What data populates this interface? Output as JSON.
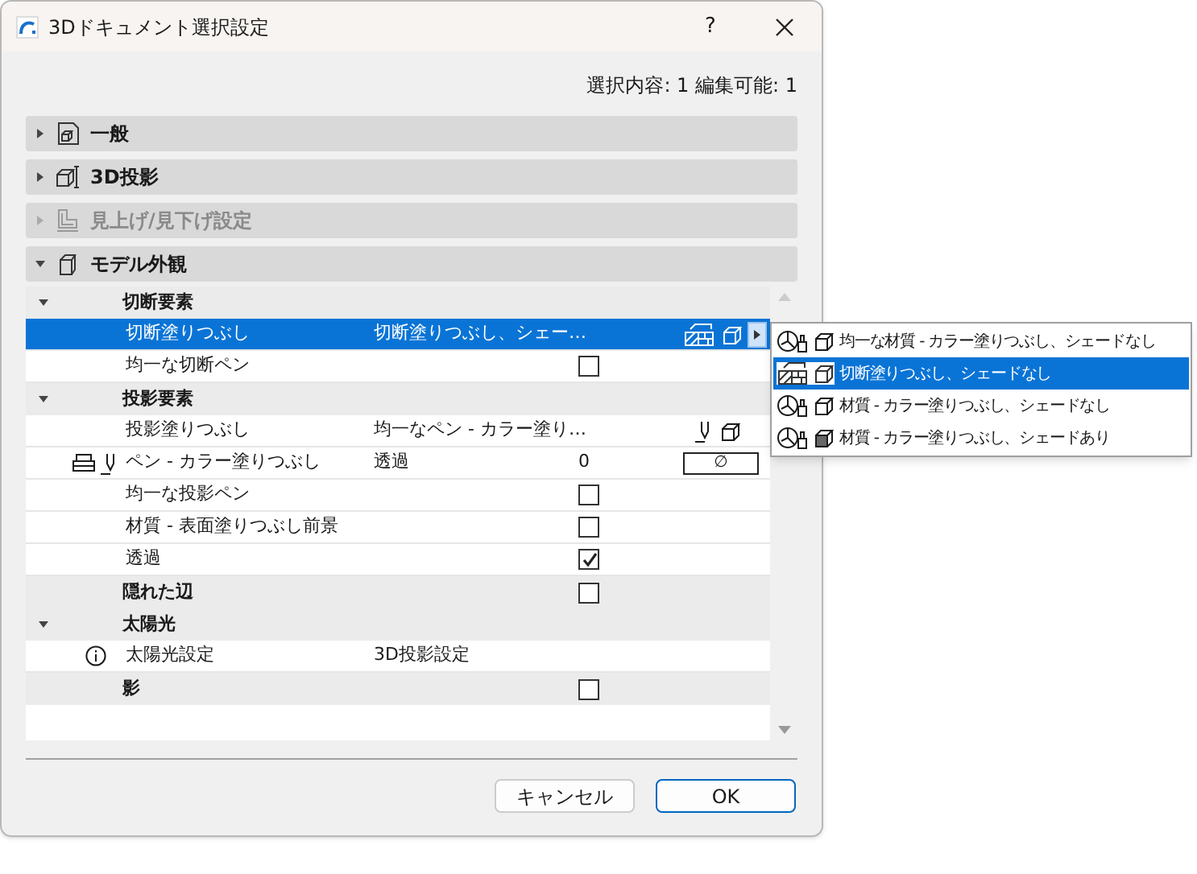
{
  "window": {
    "title": "3Dドキュメント選択設定",
    "help": "?"
  },
  "selection_info": "選択内容: 1 編集可能: 1",
  "sections": [
    {
      "label": "一般",
      "kind": "general",
      "expanded": false,
      "disabled": false
    },
    {
      "label": "3D投影",
      "kind": "projection",
      "expanded": false,
      "disabled": false
    },
    {
      "label": "見上げ/見下げ設定",
      "kind": "floor",
      "expanded": false,
      "disabled": true
    },
    {
      "label": "モデル外観",
      "kind": "model",
      "expanded": true,
      "disabled": false
    }
  ],
  "tree": [
    {
      "label": "切断要素",
      "expanded": true,
      "children": [
        {
          "kind": "cut-fill",
          "label": "切断塗りつぶし",
          "value": "切断塗りつぶし、シェー…",
          "selected": true
        },
        {
          "kind": "check",
          "label": "均一な切断ペン",
          "checked": false,
          "selected": false
        }
      ]
    },
    {
      "label": "投影要素",
      "expanded": true,
      "children": [
        {
          "kind": "projection-fill",
          "label": "投影塗りつぶし",
          "value": "均一なペン - カラー塗り…",
          "selected": false
        },
        {
          "kind": "pen",
          "label": "ペン - カラー塗りつぶし",
          "value": "透過",
          "number": "0",
          "swatch": "∅",
          "selected": false
        },
        {
          "kind": "check",
          "label": "均一な投影ペン",
          "checked": false,
          "selected": false
        },
        {
          "kind": "check",
          "label": "材質 - 表面塗りつぶし前景",
          "checked": false,
          "selected": false
        },
        {
          "kind": "check",
          "label": "透過",
          "checked": true,
          "selected": false
        }
      ]
    },
    {
      "label": "隠れた辺",
      "checked": false
    },
    {
      "label": "太陽光",
      "expanded": true,
      "children": [
        {
          "kind": "info",
          "label": "太陽光設定",
          "value": "3D投影設定",
          "selected": false
        }
      ]
    },
    {
      "label": "影",
      "checked": false
    }
  ],
  "popup_menu": [
    {
      "kind": "uniform",
      "label": "均一な材質 - カラー塗りつぶし、シェードなし",
      "selected": false
    },
    {
      "kind": "cut",
      "label": "切断塗りつぶし、シェードなし",
      "selected": true
    },
    {
      "kind": "material",
      "label": "材質 - カラー塗りつぶし、シェードなし",
      "selected": false
    },
    {
      "kind": "material-shaded",
      "label": "材質 - カラー塗りつぶし、シェードあり",
      "selected": false
    }
  ],
  "buttons": [
    {
      "label": "キャンセル",
      "default": false
    },
    {
      "label": "OK",
      "default": true
    }
  ]
}
